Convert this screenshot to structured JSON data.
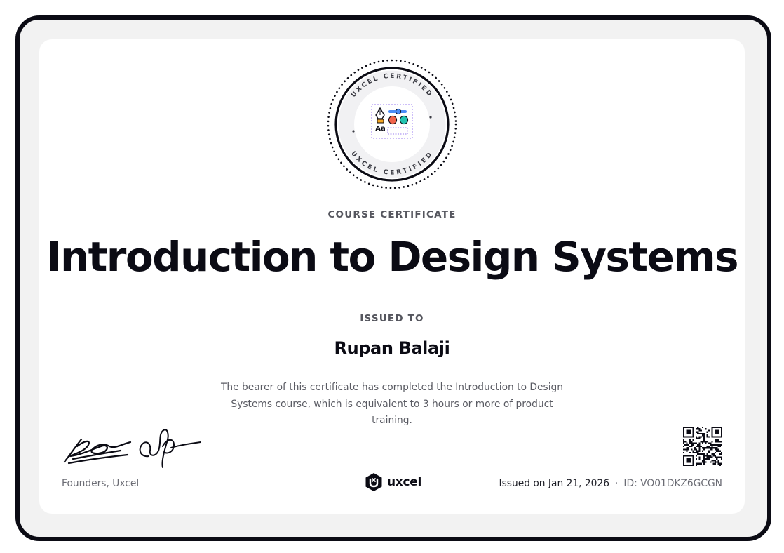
{
  "badge": {
    "ring_text_top": "UXCEL CERTIFIED",
    "ring_text_bottom": "UXCEL CERTIFIED",
    "sample_text": "Aa"
  },
  "certificate": {
    "kicker": "COURSE CERTIFICATE",
    "title": "Introduction to Design Systems",
    "issued_to_label": "ISSUED TO",
    "recipient": "Rupan Balaji",
    "description": "The bearer of this certificate has completed the Introduction to Design Systems course, which is equivalent to 3 hours or more of product training."
  },
  "footer": {
    "founders": "Founders, Uxcel",
    "brand": "uxcel",
    "issued_on": "Issued on Jan 21, 2026",
    "separator": "·",
    "id": "ID: VO01DKZ6GCGN"
  },
  "colors": {
    "frame": "#0b0b14",
    "accent_blue": "#4a8cf7",
    "accent_red": "#f0644c",
    "accent_teal": "#22c3b0",
    "accent_orange": "#f5a623",
    "accent_purple": "#9b7ef0"
  }
}
